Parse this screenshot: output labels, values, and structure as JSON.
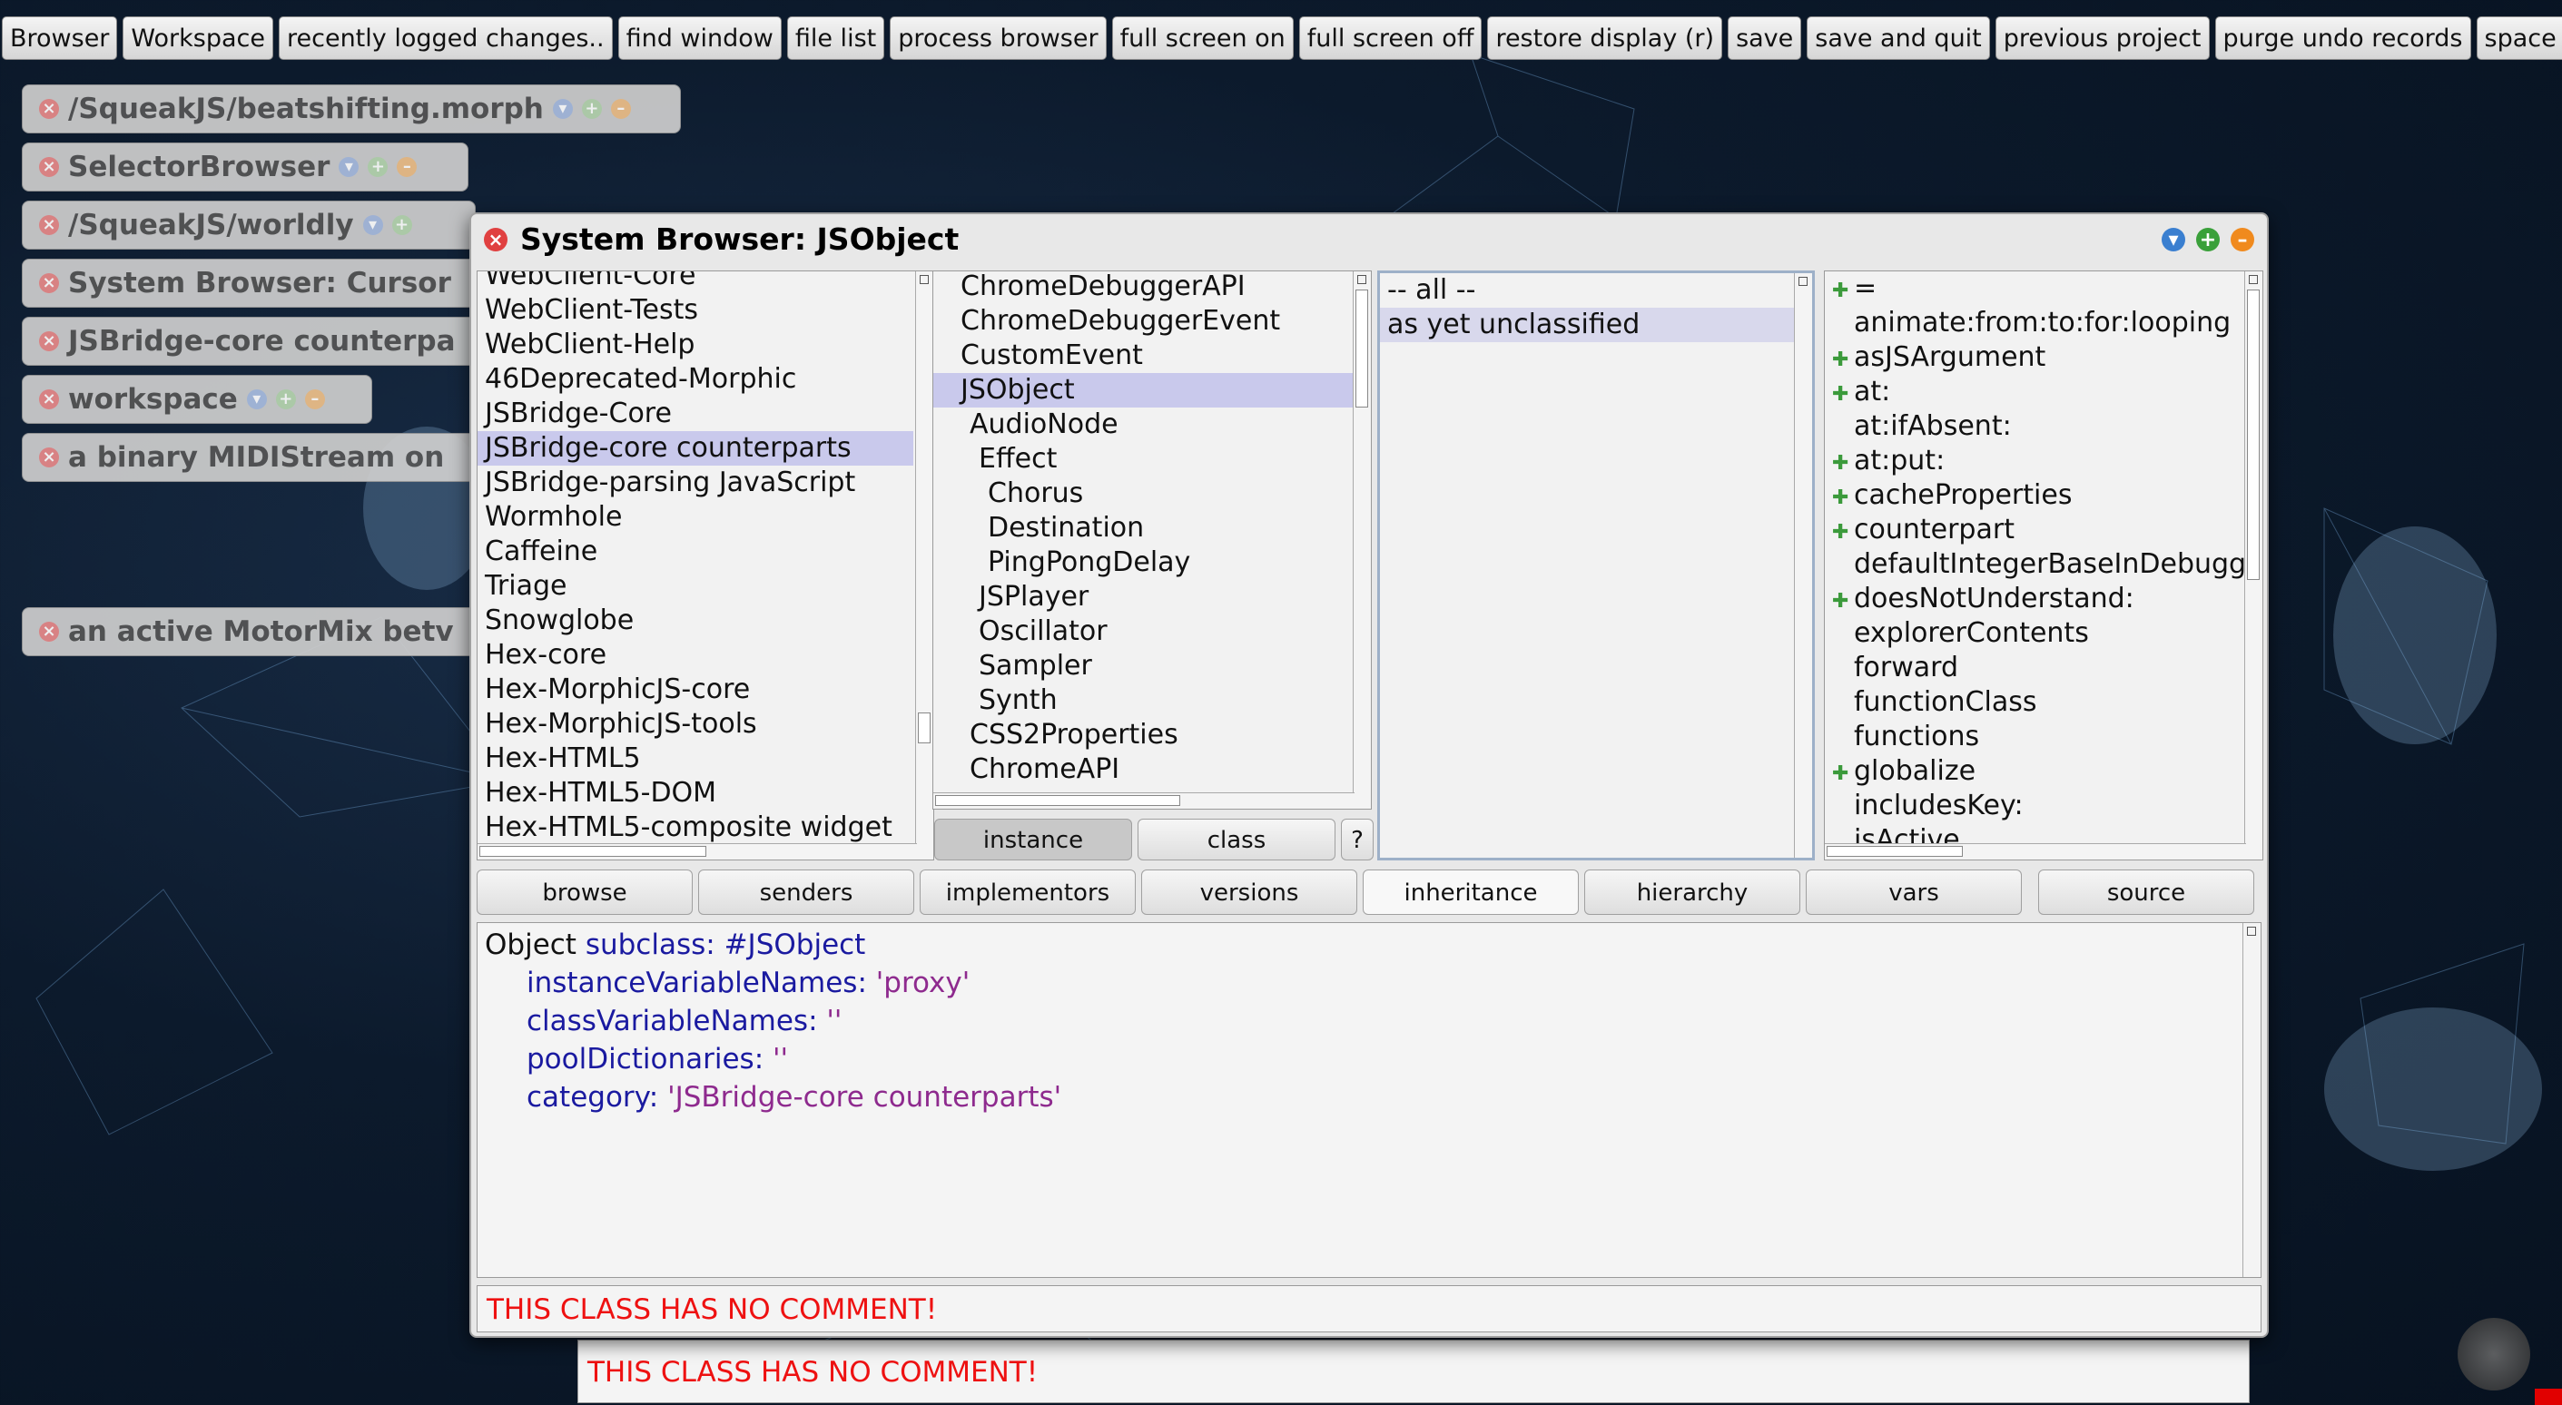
{
  "command_bar": [
    "Browser",
    "Workspace",
    "recently logged changes..",
    "find window",
    "file list",
    "process browser",
    "full screen on",
    "full screen off",
    "restore display (r)",
    "save",
    "save and quit",
    "previous project",
    "purge undo records",
    "space left"
  ],
  "collapsed_windows": [
    "/SqueakJS/beatshifting.morph",
    "SelectorBrowser",
    "/SqueakJS/worldly",
    "System Browser: Cursor",
    "JSBridge-core counterpa",
    "workspace",
    "a binary MIDIStream on",
    "an active MotorMix betv"
  ],
  "browser": {
    "title": "System Browser: JSObject",
    "categories": [
      "WebClient-Core",
      "WebClient-Tests",
      "WebClient-Help",
      "46Deprecated-Morphic",
      "JSBridge-Core",
      "JSBridge-core counterparts",
      "JSBridge-parsing JavaScript",
      "Wormhole",
      "Caffeine",
      "Triage",
      "Snowglobe",
      "Hex-core",
      "Hex-MorphicJS-core",
      "Hex-MorphicJS-tools",
      "Hex-HTML5",
      "Hex-HTML5-DOM",
      "Hex-HTML5-composite widget"
    ],
    "selected_category": "JSBridge-core counterparts",
    "classes": [
      {
        "name": "ChromeDebuggerAPI",
        "indent": 0
      },
      {
        "name": "ChromeDebuggerEvent",
        "indent": 0
      },
      {
        "name": "CustomEvent",
        "indent": 0
      },
      {
        "name": "JSObject",
        "indent": 0
      },
      {
        "name": "AudioNode",
        "indent": 1
      },
      {
        "name": "Effect",
        "indent": 2
      },
      {
        "name": "Chorus",
        "indent": 3
      },
      {
        "name": "Destination",
        "indent": 3
      },
      {
        "name": "PingPongDelay",
        "indent": 3
      },
      {
        "name": "JSPlayer",
        "indent": 2
      },
      {
        "name": "Oscillator",
        "indent": 2
      },
      {
        "name": "Sampler",
        "indent": 2
      },
      {
        "name": "Synth",
        "indent": 2
      },
      {
        "name": "CSS2Properties",
        "indent": 1
      },
      {
        "name": "ChromeAPI",
        "indent": 1
      }
    ],
    "selected_class": "JSObject",
    "class_buttons": {
      "instance": "instance",
      "class": "class",
      "help": "?"
    },
    "protocols": [
      "-- all --",
      "as yet unclassified"
    ],
    "selected_protocol": "as yet unclassified",
    "methods": [
      {
        "name": "=",
        "marked": true
      },
      {
        "name": "animate:from:to:for:looping",
        "marked": false
      },
      {
        "name": "asJSArgument",
        "marked": true
      },
      {
        "name": "at:",
        "marked": true
      },
      {
        "name": "at:ifAbsent:",
        "marked": false
      },
      {
        "name": "at:put:",
        "marked": true
      },
      {
        "name": "cacheProperties",
        "marked": true
      },
      {
        "name": "counterpart",
        "marked": true
      },
      {
        "name": "defaultIntegerBaseInDebugger",
        "marked": false
      },
      {
        "name": "doesNotUnderstand:",
        "marked": true
      },
      {
        "name": "explorerContents",
        "marked": false
      },
      {
        "name": "forward",
        "marked": false
      },
      {
        "name": "functionClass",
        "marked": false
      },
      {
        "name": "functions",
        "marked": false
      },
      {
        "name": "globalize",
        "marked": true
      },
      {
        "name": "includesKey:",
        "marked": false
      },
      {
        "name": "isActive",
        "marked": false
      }
    ],
    "toolbar": [
      "browse",
      "senders",
      "implementors",
      "versions",
      "inheritance",
      "hierarchy",
      "vars",
      "source"
    ],
    "definition": {
      "line1_a": "Object",
      "line1_b": "subclass:",
      "line1_c": "#JSObject",
      "line2_a": "instanceVariableNames:",
      "line2_b": "'proxy'",
      "line3_a": "classVariableNames:",
      "line3_b": "''",
      "line4_a": "poolDictionaries:",
      "line4_b": "''",
      "line5_a": "category:",
      "line5_b": "'JSBridge-core counterparts'"
    },
    "comment": "THIS CLASS HAS NO COMMENT!"
  },
  "background_comment": "THIS CLASS HAS NO COMMENT!"
}
